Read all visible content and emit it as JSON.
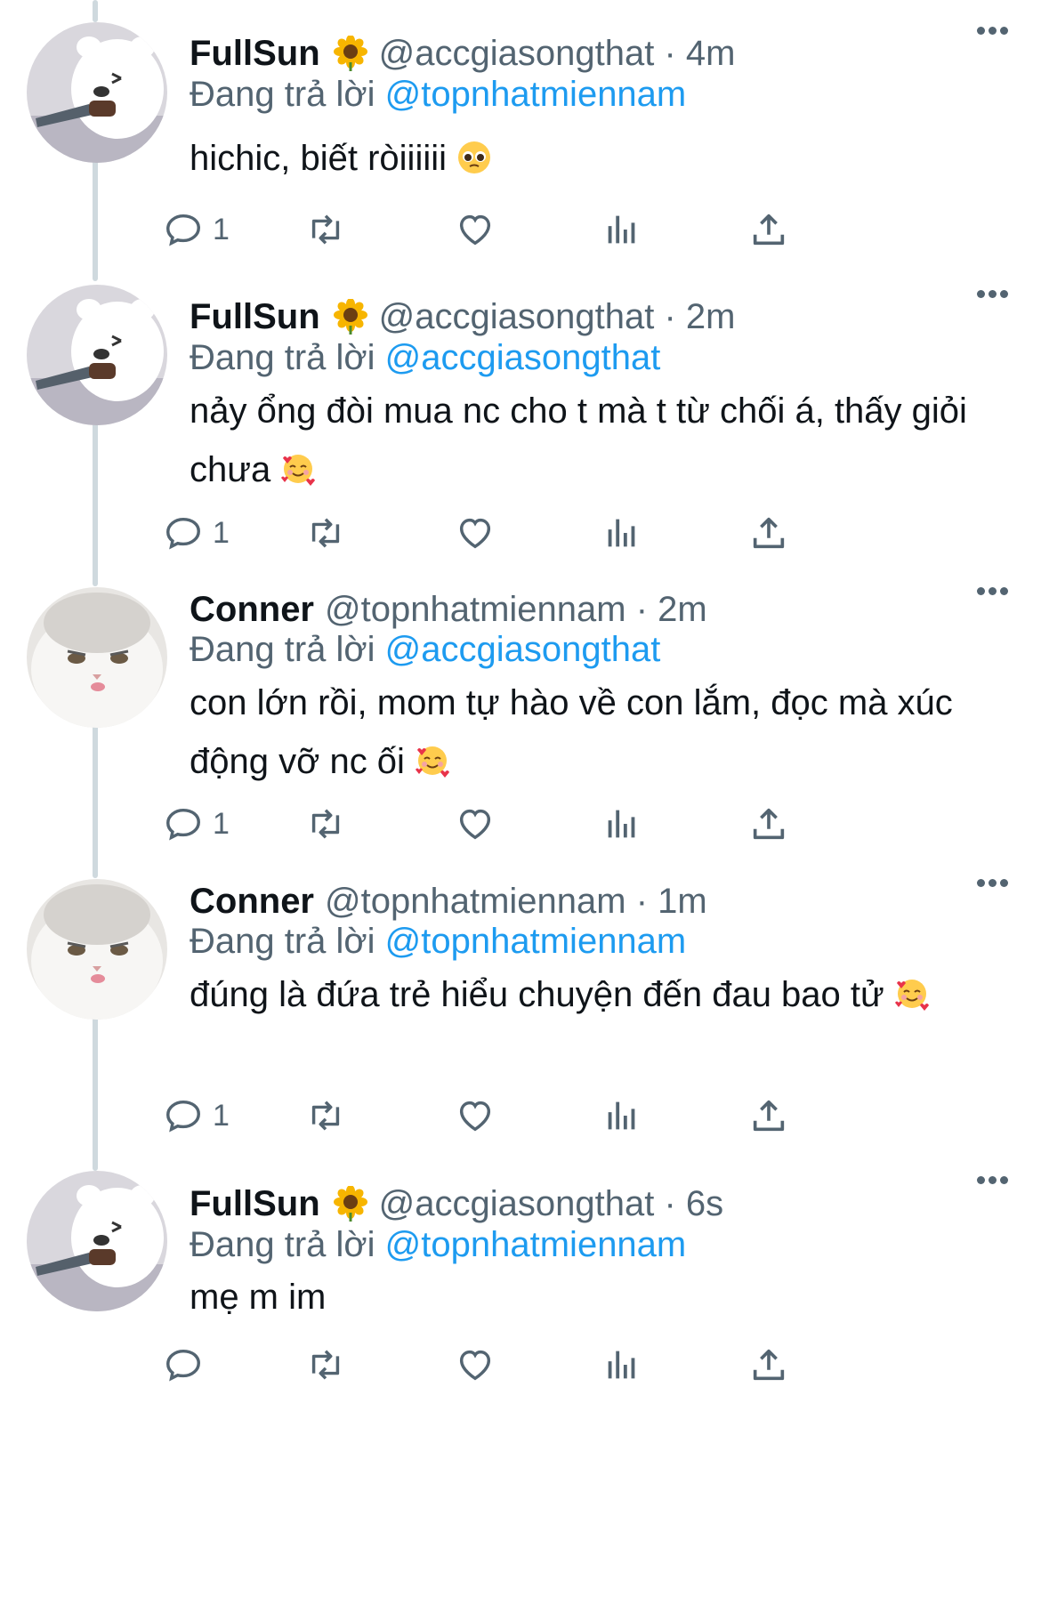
{
  "tweets": [
    {
      "name": "FullSun",
      "handle": "@accgiasongthat · 4m",
      "reply_prefix": "Đang trả lời",
      "reply_to": "@topnhatmiennam",
      "text": "hichic, biết ròiiiiii",
      "emoji": "pleading-face",
      "reply_count": "1",
      "avatar": "bear"
    },
    {
      "name": "FullSun",
      "handle": "@accgiasongthat · 2m",
      "reply_prefix": "Đang trả lời",
      "reply_to": "@accgiasongthat",
      "text": "nảy ổng đòi mua nc cho t mà t từ chối á, thấy giỏi chưa",
      "emoji": "smiling-face-with-hearts",
      "reply_count": "1",
      "avatar": "bear"
    },
    {
      "name": "Conner",
      "handle": "@topnhatmiennam · 2m",
      "reply_prefix": "Đang trả lời",
      "reply_to": "@accgiasongthat",
      "text": "con lớn rồi, mom tự hào về con lắm, đọc mà xúc động vỡ nc ối",
      "emoji": "smiling-face-with-hearts",
      "reply_count": "1",
      "avatar": "cat"
    },
    {
      "name": "Conner",
      "handle": "@topnhatmiennam · 1m",
      "reply_prefix": "Đang trả lời",
      "reply_to": "@topnhatmiennam",
      "text": "đúng là đứa trẻ hiểu chuyện đến đau bao tử",
      "emoji": "smiling-face-with-hearts",
      "reply_count": "1",
      "avatar": "cat"
    },
    {
      "name": "FullSun",
      "handle": "@accgiasongthat · 6s",
      "reply_prefix": "Đang trả lời",
      "reply_to": "@topnhatmiennam",
      "text": "mẹ m im",
      "emoji": "",
      "reply_count": "",
      "avatar": "bear"
    }
  ],
  "icons": {
    "reply": "reply-icon",
    "retweet": "retweet-icon",
    "like": "heart-icon",
    "views": "views-icon",
    "share": "share-icon",
    "more": "more-icon",
    "badge": "sunflower-icon"
  },
  "colors": {
    "mention": "#1d9bf0",
    "secondary": "#536471",
    "thread_line": "#cfd9de"
  }
}
